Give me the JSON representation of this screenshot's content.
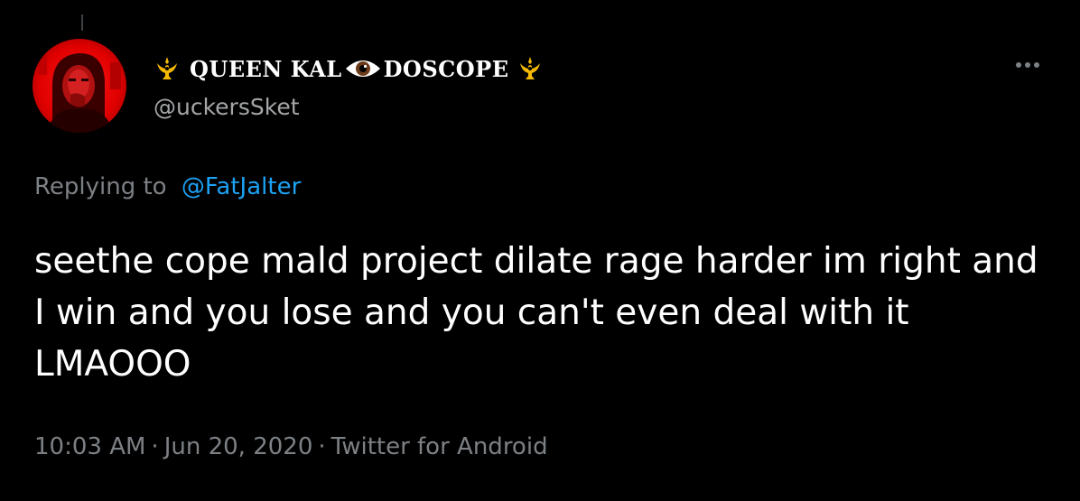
{
  "tweet": {
    "author": {
      "display_name_part1": "QUEEN KAL",
      "display_name_part2": "DOSCOPE",
      "handle": "@uckersSket",
      "left_emoji": "rebel-alliance-crest-icon",
      "middle_emoji": "eye-icon",
      "right_emoji": "rebel-alliance-crest-icon",
      "avatar": "red-tinted-photo-avatar"
    },
    "reply_prefix": "Replying to",
    "reply_to": "@FatJalter",
    "text": "seethe cope mald project dilate rage harder im right and I win and you lose and you can't even deal with it LMAOOO",
    "time": "10:03 AM",
    "date": "Jun 20, 2020",
    "separator": "·",
    "source": "Twitter for Android",
    "more_icon": "more-options-icon"
  },
  "colors": {
    "background": "#000000",
    "text_primary": "#ffffff",
    "text_secondary": "#7d8185",
    "link": "#1da1f2",
    "crest": "#f5b800",
    "avatar_red": "#e50000"
  }
}
